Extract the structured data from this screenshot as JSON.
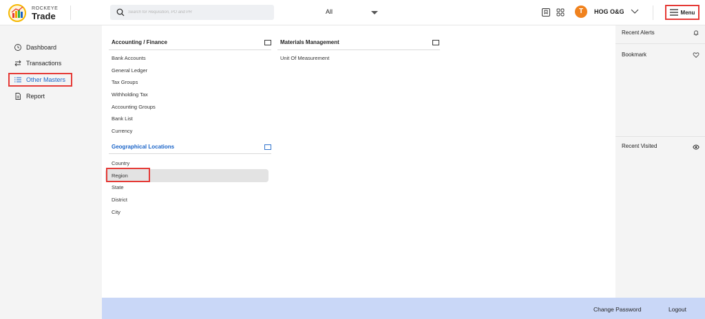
{
  "brand": {
    "top": "ROCKEYE",
    "bottom": "Trade"
  },
  "search": {
    "placeholder": "Search for Requisition, PO and PR",
    "scope": "All"
  },
  "user": {
    "initial": "T",
    "company": "HOG O&G"
  },
  "header": {
    "menu_label": "Menu"
  },
  "sidebar": {
    "items": [
      {
        "label": "Dashboard",
        "icon": "clock-icon"
      },
      {
        "label": "Transactions",
        "icon": "swap-icon"
      },
      {
        "label": "Other Masters",
        "icon": "list-icon",
        "active": true
      },
      {
        "label": "Report",
        "icon": "document-icon"
      }
    ]
  },
  "main": {
    "accounting": {
      "title": "Accounting / Finance",
      "links": [
        "Bank Accounts",
        "General Ledger",
        "Tax Groups",
        "Withholding Tax",
        "Accounting Groups",
        "Bank List",
        "Currency"
      ]
    },
    "geo": {
      "title": "Geographical Locations",
      "links": [
        "Country",
        "Region",
        "State",
        "District",
        "City"
      ]
    },
    "materials": {
      "title": "Materials Management",
      "links": [
        "Unit Of Measurement"
      ]
    }
  },
  "rightpanel": {
    "alerts": "Recent Alerts",
    "bookmark": "Bookmark",
    "visited": "Recent Visited"
  },
  "footer": {
    "change_password": "Change Password",
    "logout": "Logout"
  },
  "colors": {
    "accent": "#1a64c8",
    "highlight": "#e53935",
    "avatar": "#f0821e",
    "footer": "#c9d7f7"
  }
}
